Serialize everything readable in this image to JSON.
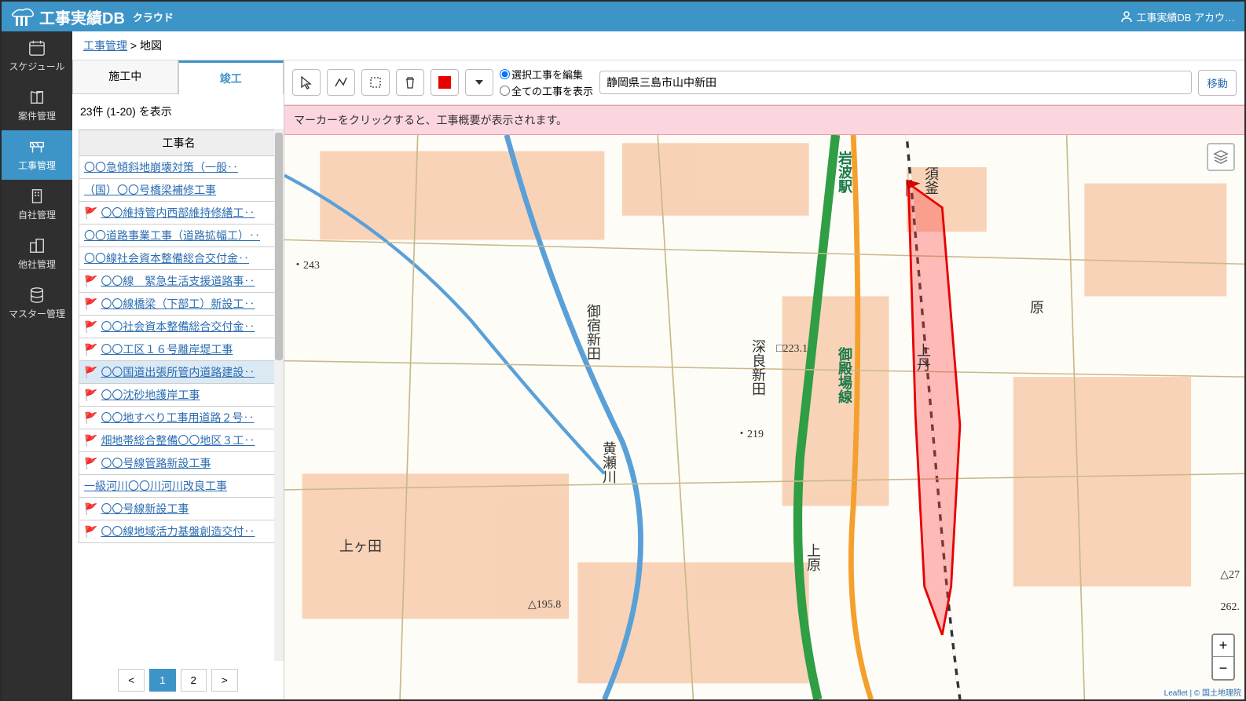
{
  "header": {
    "app_name": "工事実績DB",
    "app_sub": "クラウド",
    "account_label": "工事実績DB アカウ…"
  },
  "nav": {
    "items": [
      {
        "label": "スケジュール",
        "icon": "calendar"
      },
      {
        "label": "案件管理",
        "icon": "book"
      },
      {
        "label": "工事管理",
        "icon": "barrier",
        "active": true
      },
      {
        "label": "自社管理",
        "icon": "building"
      },
      {
        "label": "他社管理",
        "icon": "buildings"
      },
      {
        "label": "マスター管理",
        "icon": "database"
      }
    ]
  },
  "breadcrumb": {
    "root": "工事管理",
    "sep": " > ",
    "current": "地図"
  },
  "tabs": {
    "items": [
      {
        "label": "施工中"
      },
      {
        "label": "竣工",
        "active": true
      }
    ]
  },
  "list": {
    "count_label": "23件 (1-20) を表示",
    "header": "工事名",
    "projects": [
      {
        "flag": false,
        "name": "〇〇急傾斜地崩壊対策（一般‥"
      },
      {
        "flag": false,
        "name": "（国）〇〇号橋梁補修工事"
      },
      {
        "flag": true,
        "name": "〇〇維持管内西部維持修繕工‥"
      },
      {
        "flag": false,
        "name": "〇〇道路事業工事（道路拡幅工）‥"
      },
      {
        "flag": false,
        "name": "〇〇線社会資本整備総合交付金‥"
      },
      {
        "flag": true,
        "name": "〇〇線　緊急生活支援道路事‥"
      },
      {
        "flag": true,
        "name": "〇〇線橋梁（下部工）新設工‥"
      },
      {
        "flag": true,
        "name": "〇〇社会資本整備総合交付金‥"
      },
      {
        "flag": true,
        "name": "〇〇工区１６号離岸堤工事"
      },
      {
        "flag": true,
        "name": "〇〇国道出張所管内道路建設‥",
        "selected": true
      },
      {
        "flag": true,
        "name": "〇〇沈砂地護岸工事"
      },
      {
        "flag": true,
        "name": "〇〇地すべり工事用道路２号‥"
      },
      {
        "flag": true,
        "name": "畑地帯総合整備〇〇地区３工‥"
      },
      {
        "flag": true,
        "name": "〇〇号線管路新設工事"
      },
      {
        "flag": false,
        "name": "一級河川〇〇川河川改良工事"
      },
      {
        "flag": true,
        "name": "〇〇号線新設工事"
      },
      {
        "flag": true,
        "name": "〇〇線地域活力基盤創造交付‥"
      }
    ]
  },
  "pagination": {
    "prev": "<",
    "pages": [
      "1",
      "2"
    ],
    "next": ">",
    "active": "1"
  },
  "toolbar": {
    "radios": {
      "edit": "選択工事を編集",
      "show_all": "全ての工事を表示"
    },
    "address": "静岡県三島市山中新田",
    "move": "移動"
  },
  "info_bar": "マーカーをクリックすると、工事概要が表示されます。",
  "map": {
    "labels": {
      "iwanami": "岩波駅",
      "suga": "須釜",
      "hara": "原",
      "kamitan": "上丹",
      "fukara": "深良新田",
      "mishuku": "御宿新田",
      "uehara": "上原",
      "kamigeta": "上ヶ田",
      "gotemba": "御殿場線",
      "kise": "黄瀬川",
      "pt243": "・243",
      "pt223": "□223.1",
      "pt219": "・219",
      "tri195": "△195.8",
      "tri27": "△27",
      "pt262": "262."
    },
    "attribution": "Leaflet | © 国土地理院"
  }
}
